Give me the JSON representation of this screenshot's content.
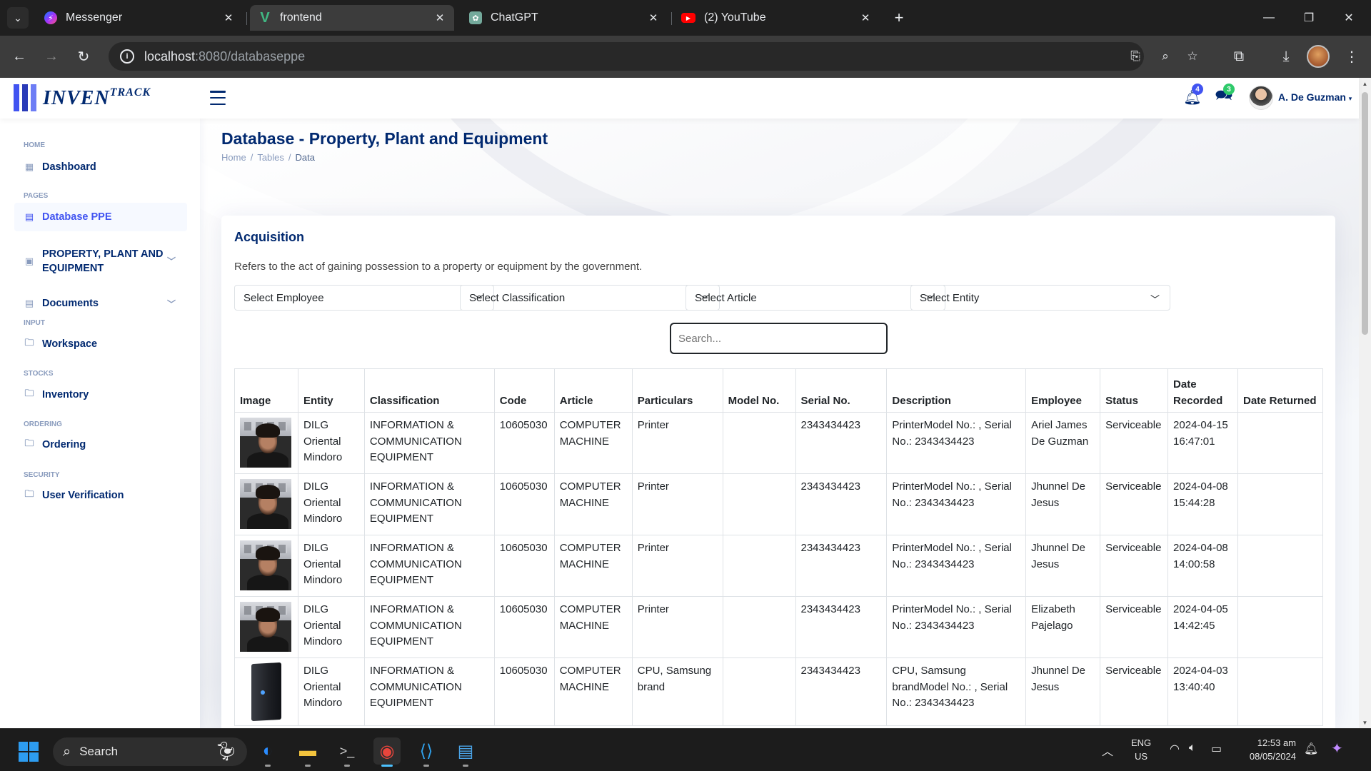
{
  "browser": {
    "tabs": [
      {
        "title": "Messenger",
        "icon": "messenger-icon",
        "color": "#a033ff"
      },
      {
        "title": "frontend",
        "icon": "vue-icon",
        "color": "#41b883"
      },
      {
        "title": "ChatGPT",
        "icon": "chatgpt-icon",
        "color": "#74aa9c"
      },
      {
        "title": "(2) YouTube",
        "icon": "youtube-icon",
        "color": "#ff0000"
      }
    ],
    "url_host": "localhost",
    "url_path": ":8080/databaseppe"
  },
  "app": {
    "logo": "INVENTRACK",
    "notif_count": "4",
    "msg_count": "3",
    "user_name": "A. De Guzman",
    "accent": "#4154f1",
    "navy": "#012970"
  },
  "sidebar": {
    "sections": {
      "home": "HOME",
      "pages": "PAGES",
      "input": "INPUT",
      "stocks": "STOCKS",
      "ordering": "ORDERING",
      "security": "SECURITY"
    },
    "items": {
      "dashboard": "Dashboard",
      "database_ppe": "Database PPE",
      "ppe_line1": "PROPERTY, PLANT AND",
      "ppe_line2": "EQUIPMENT",
      "documents": "Documents",
      "workspace": "Workspace",
      "inventory": "Inventory",
      "ordering": "Ordering",
      "user_verification": "User Verification"
    }
  },
  "main": {
    "title": "Database - Property, Plant and Equipment",
    "breadcrumbs": [
      "Home",
      "Tables",
      "Data"
    ],
    "card": {
      "title": "Acquisition",
      "description": "Refers to the act of gaining possession to a property or equipment by the government.",
      "filters": [
        "Select Employee",
        "Select Classification",
        "Select Article",
        "Select Entity"
      ],
      "search_placeholder": "Search..."
    },
    "table": {
      "headers": [
        "Image",
        "Entity",
        "Classification",
        "Code",
        "Article",
        "Particulars",
        "Model No.",
        "Serial No.",
        "Description",
        "Employee",
        "Status",
        "Date Recorded",
        "Date Returned"
      ],
      "rows": [
        {
          "image": "person-photo",
          "entity": "DILG Oriental Mindoro",
          "classification": "INFORMATION & COMMUNICATION EQUIPMENT",
          "code": "10605030",
          "article": "COMPUTER MACHINE",
          "particulars": "Printer",
          "model": "",
          "serial": "2343434423",
          "description": "PrinterModel No.: , Serial No.: 2343434423",
          "employee": "Ariel James De Guzman",
          "status": "Serviceable",
          "date_recorded": "2024-04-15 16:47:01",
          "date_returned": ""
        },
        {
          "image": "person-photo",
          "entity": "DILG Oriental Mindoro",
          "classification": "INFORMATION & COMMUNICATION EQUIPMENT",
          "code": "10605030",
          "article": "COMPUTER MACHINE",
          "particulars": "Printer",
          "model": "",
          "serial": "2343434423",
          "description": "PrinterModel No.: , Serial No.: 2343434423",
          "employee": "Jhunnel De Jesus",
          "status": "Serviceable",
          "date_recorded": "2024-04-08 15:44:28",
          "date_returned": ""
        },
        {
          "image": "person-photo",
          "entity": "DILG Oriental Mindoro",
          "classification": "INFORMATION & COMMUNICATION EQUIPMENT",
          "code": "10605030",
          "article": "COMPUTER MACHINE",
          "particulars": "Printer",
          "model": "",
          "serial": "2343434423",
          "description": "PrinterModel No.: , Serial No.: 2343434423",
          "employee": "Jhunnel De Jesus",
          "status": "Serviceable",
          "date_recorded": "2024-04-08 14:00:58",
          "date_returned": ""
        },
        {
          "image": "person-photo",
          "entity": "DILG Oriental Mindoro",
          "classification": "INFORMATION & COMMUNICATION EQUIPMENT",
          "code": "10605030",
          "article": "COMPUTER MACHINE",
          "particulars": "Printer",
          "model": "",
          "serial": "2343434423",
          "description": "PrinterModel No.: , Serial No.: 2343434423",
          "employee": "Elizabeth Pajelago",
          "status": "Serviceable",
          "date_recorded": "2024-04-05 14:42:45",
          "date_returned": ""
        },
        {
          "image": "cpu-photo",
          "entity": "DILG Oriental Mindoro",
          "classification": "INFORMATION & COMMUNICATION EQUIPMENT",
          "code": "10605030",
          "article": "COMPUTER MACHINE",
          "particulars": "CPU, Samsung brand",
          "model": "",
          "serial": "2343434423",
          "description": "CPU, Samsung brandModel No.: , Serial No.: 2343434423",
          "employee": "Jhunnel De Jesus",
          "status": "Serviceable",
          "date_recorded": "2024-04-03 13:40:40",
          "date_returned": ""
        }
      ]
    }
  },
  "taskbar": {
    "search_label": "Search",
    "lang_line1": "ENG",
    "lang_line2": "US",
    "time": "12:53 am",
    "date": "08/05/2024"
  }
}
